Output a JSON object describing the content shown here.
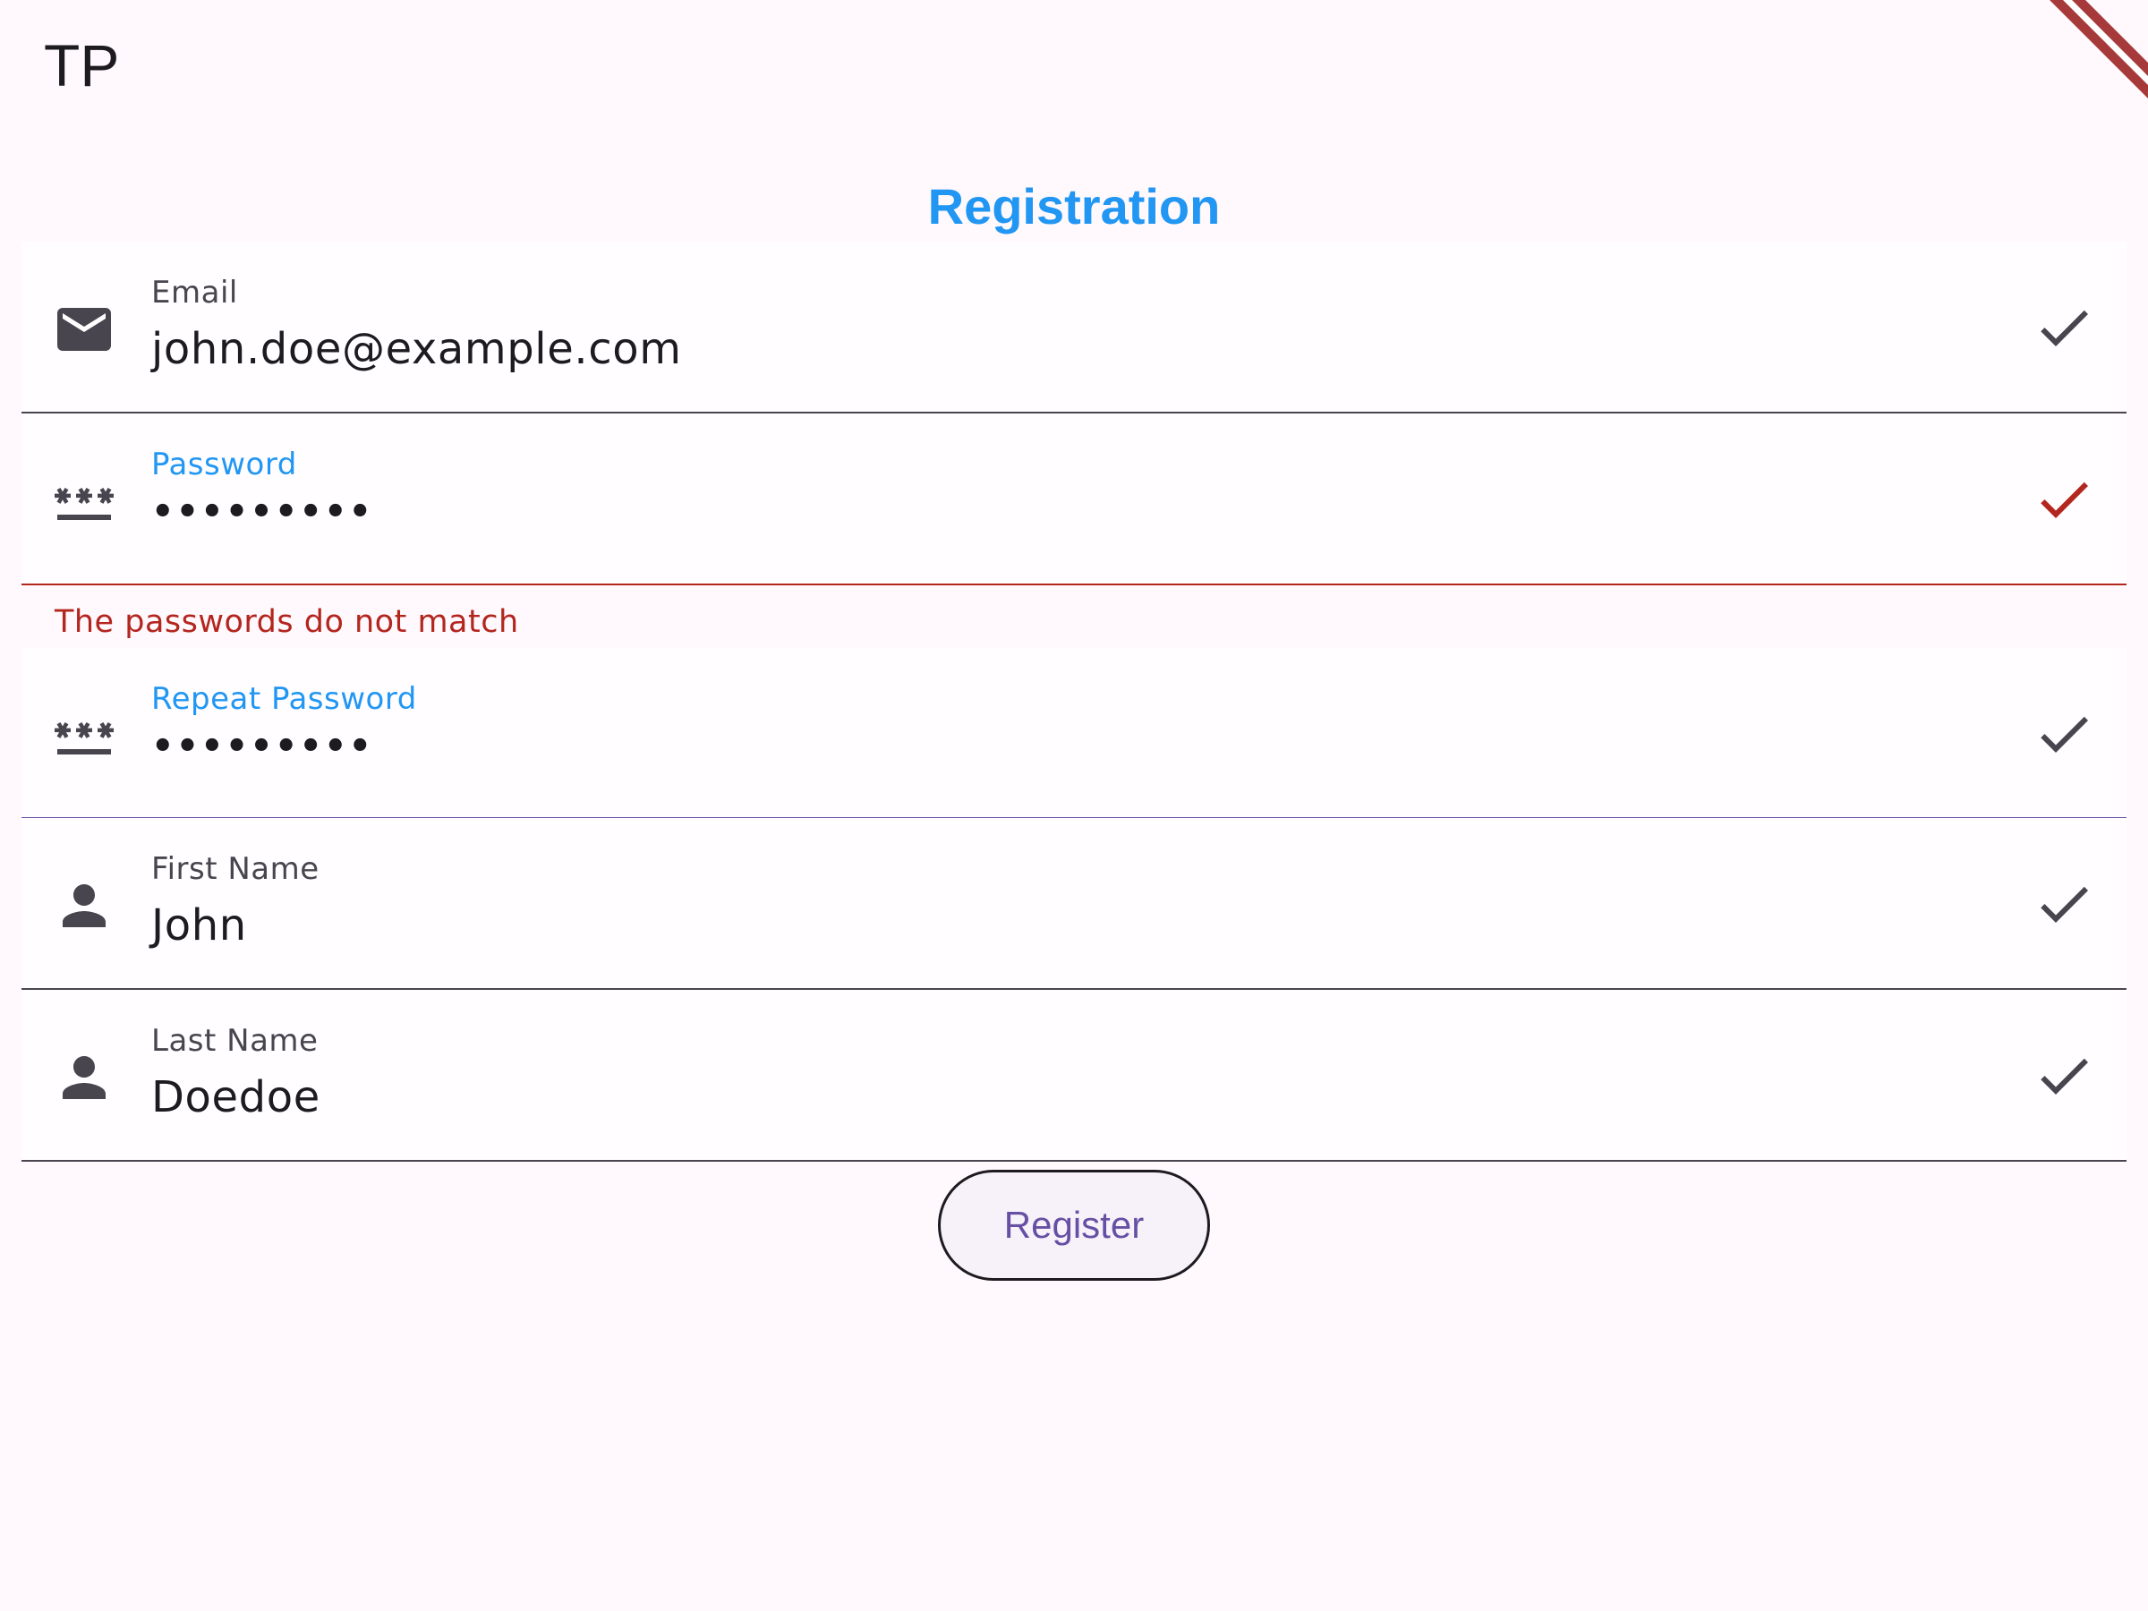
{
  "app": {
    "title": "TP"
  },
  "page": {
    "title": "Registration"
  },
  "fields": {
    "email": {
      "label": "Email",
      "value": "john.doe@example.com",
      "icon": "mail-icon"
    },
    "password": {
      "label": "Password",
      "value": "•••••••••",
      "icon": "password-icon",
      "error": "The passwords do not match"
    },
    "repeat_password": {
      "label": "Repeat Password",
      "value": "•••••••••",
      "icon": "password-icon"
    },
    "first_name": {
      "label": "First Name",
      "value": "John",
      "icon": "person-icon"
    },
    "last_name": {
      "label": "Last Name",
      "value": "Doedoe",
      "icon": "person-icon"
    }
  },
  "actions": {
    "register_label": "Register"
  },
  "colors": {
    "accent": "#2196F3",
    "primary": "#6750A4",
    "error": "#B3261E",
    "background": "#FFF8FD",
    "icon": "#49454F"
  }
}
